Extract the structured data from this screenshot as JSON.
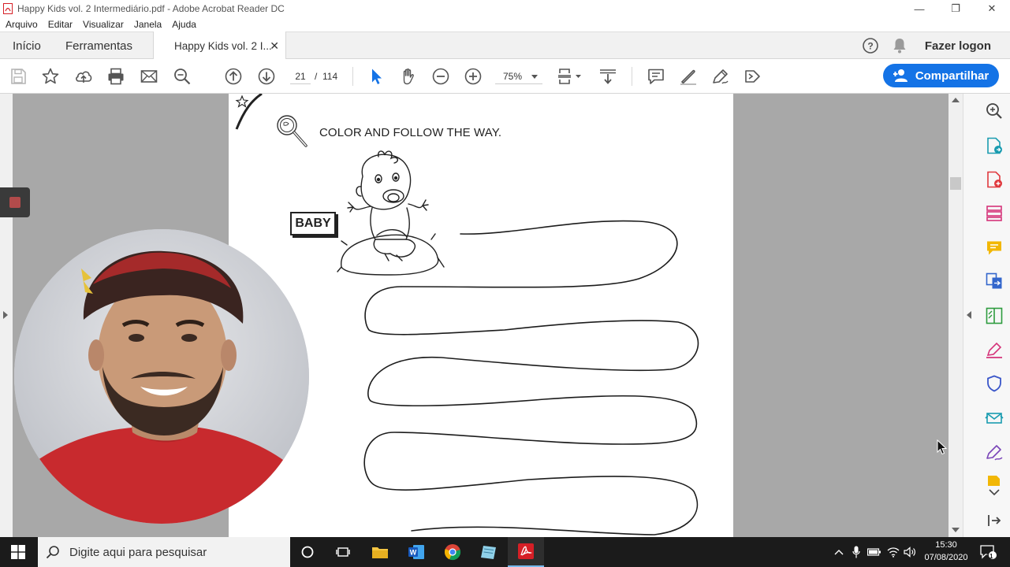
{
  "window": {
    "title": "Happy Kids vol. 2 Intermediário.pdf - Adobe Acrobat Reader DC",
    "minimize_glyph": "—",
    "restore_glyph": "❐",
    "close_glyph": "✕"
  },
  "menu": [
    "Arquivo",
    "Editar",
    "Visualizar",
    "Janela",
    "Ajuda"
  ],
  "tabs": {
    "home": "Início",
    "tools": "Ferramentas",
    "document": "Happy Kids vol. 2 I...",
    "document_close": "✕",
    "login": "Fazer logon"
  },
  "toolbar": {
    "current_page": "21",
    "page_separator": "/",
    "total_pages": "114",
    "zoom": "75%",
    "share_label": "Compartilhar"
  },
  "document": {
    "instruction": "COLOR AND FOLLOW THE WAY.",
    "label_box": "BABY"
  },
  "taskbar": {
    "search_placeholder": "Digite aqui para pesquisar",
    "time": "15:30",
    "date": "07/08/2020",
    "notification_count": "11"
  },
  "colors": {
    "accent": "#1473e6",
    "acrobat_red": "#d61f26",
    "taskbar": "#1b1b1b",
    "doc_background": "#a8a8a8"
  },
  "icons": {
    "toolbar": [
      "save-icon",
      "bookmark-star-icon",
      "upload-cloud-icon",
      "print-icon",
      "email-icon",
      "zoom-search-icon",
      "page-up-icon",
      "page-down-icon",
      "select-arrow-icon",
      "hand-icon",
      "zoom-out-icon",
      "zoom-in-icon",
      "fit-page-icon",
      "scroll-mode-icon",
      "comment-icon",
      "highlight-icon",
      "sign-icon",
      "more-tools-icon"
    ],
    "right_pane": [
      "search-icon",
      "export-pdf-icon",
      "create-pdf-icon",
      "organize-pages-icon",
      "comment-icon",
      "combine-files-icon",
      "edit-pdf-icon",
      "fill-sign-icon",
      "protect-icon",
      "send-review-icon",
      "sign-icon",
      "more-icon"
    ]
  }
}
